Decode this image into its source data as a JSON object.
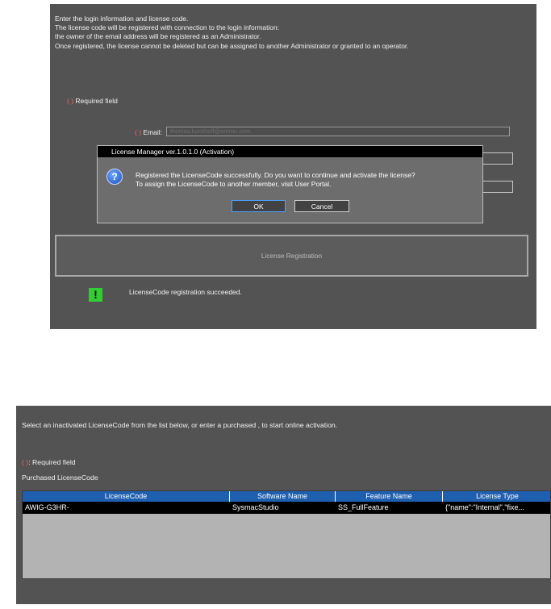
{
  "top": {
    "intro_lines": [
      "Enter the login information and license code.",
      "The license code will be registered with connection to the login information:",
      "the owner of the email address will be registered as an Administrator.",
      "Once registered, the license cannot be deleted but can be assigned to another Administrator or granted to an operator."
    ],
    "required_paren": "( )",
    "required_text": " Required field",
    "email_label": "Email:",
    "email_value": "thomas.kuckhoff@omron.com",
    "registration_button": "License Registration",
    "success_icon": "!",
    "success_message": "LicenseCode registration succeeded."
  },
  "dialog": {
    "title": "License Manager ver.1.0.1.0 (Activation)",
    "question_icon": "?",
    "message_lines": [
      "Registered the LicenseCode successfully. Do you want to continue and activate the license?",
      "To assign the LicenseCode to another member, visit User Portal."
    ],
    "ok_label": "OK",
    "cancel_label": "Cancel"
  },
  "bottom": {
    "instruction": "Select an inactivated LicenseCode from the list below, or enter a purchased , to start online activation.",
    "required_paren": "( )",
    "required_text": ": Required field",
    "purchased_label": "Purchased LicenseCode",
    "columns": [
      "LicenseCode",
      "Software Name",
      "Feature Name",
      "License Type"
    ],
    "row": [
      "AWIG-G3HR-",
      "SysmacStudio",
      "SS_FullFeature",
      "{\"name\":\"Internal\",\"fixe..."
    ]
  },
  "colors": {
    "panel_bg": "#535353",
    "header_blue": "#1f5fb0",
    "success_green": "#33cc33",
    "required_red": "#ff6060"
  }
}
